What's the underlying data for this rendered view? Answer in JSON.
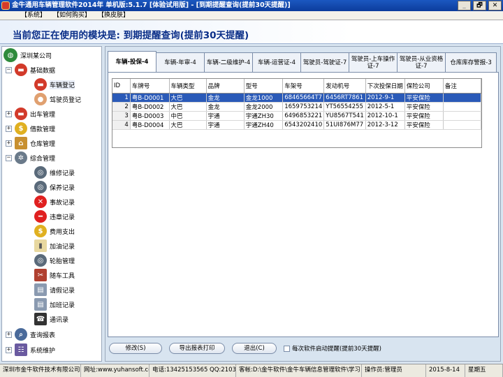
{
  "window": {
    "title": "金牛通用车辆管理软件2014年 单机版:5.1.7 [体验试用版] - [到期提醒查询(提前30天提醒)]",
    "buttons": [
      "_",
      "🗗",
      "✕"
    ]
  },
  "menu": [
    "【系统】",
    "【如何购买】",
    "【换皮肤】"
  ],
  "banner": "当前您正在使用的模块是: 到期提醒查询(提前30天提醒)",
  "tree": {
    "root": "深圳某公司",
    "items": [
      {
        "label": "基础数据",
        "toggle": "−"
      },
      {
        "label": "车辆登记"
      },
      {
        "label": "驾驶员登记"
      },
      {
        "label": "出车管理",
        "toggle": "+"
      },
      {
        "label": "借款管理",
        "toggle": "+"
      },
      {
        "label": "仓库管理",
        "toggle": "+"
      },
      {
        "label": "综合管理",
        "toggle": "−"
      },
      {
        "label": "维修记录"
      },
      {
        "label": "保养记录"
      },
      {
        "label": "事故记录"
      },
      {
        "label": "违章记录"
      },
      {
        "label": "费用支出"
      },
      {
        "label": "加油记录"
      },
      {
        "label": "轮胎管理"
      },
      {
        "label": "随车工具"
      },
      {
        "label": "请假记录"
      },
      {
        "label": "加班记录"
      },
      {
        "label": "通讯录"
      },
      {
        "label": "查询报表",
        "toggle": "+"
      },
      {
        "label": "系统维护",
        "toggle": "+"
      }
    ]
  },
  "tabs": [
    "车辆-投保-4",
    "车辆-年审-4",
    "车辆-二级维护-4",
    "车辆-运营证-4",
    "驾驶员-驾驶证-7",
    "驾驶员-上车操作证-7",
    "驾驶员-从业资格证-7",
    "仓库库存警报-3"
  ],
  "table": {
    "columns": [
      "ID",
      "车牌号",
      "车辆类型",
      "品牌",
      "型号",
      "车架号",
      "发动机号",
      "下次投保日期",
      "保险公司",
      "备注"
    ],
    "rows": [
      [
        "1",
        "粤B-D0001",
        "大巴",
        "金龙",
        "金龙1000",
        "68465664T7",
        "6456RT7861",
        "2012-9-1",
        "平安保险",
        ""
      ],
      [
        "2",
        "粤B-D0002",
        "大巴",
        "金龙",
        "金龙2000",
        "1659753214",
        "YT56554255",
        "2012-5-1",
        "平安保险",
        ""
      ],
      [
        "3",
        "粤B-D0003",
        "中巴",
        "宇通",
        "宇通ZH30",
        "6496853221",
        "YU8567T541",
        "2012-10-1",
        "平安保险",
        ""
      ],
      [
        "4",
        "粤B-D0004",
        "大巴",
        "宇通",
        "宇通ZH40",
        "6543202410",
        "51UI876M77",
        "2012-3-12",
        "平安保险",
        ""
      ]
    ]
  },
  "buttons": {
    "edit": "修改(S)",
    "export": "导出报表打印",
    "exit": "退出(C)",
    "startup_check": "每次软件启动提醒(提前30天提醒)"
  },
  "status": {
    "company": "深圳市金牛软件技术有限公司",
    "website": "网址:www.yuhansoft.com",
    "phone": "电话:13425153565 QQ:21035391",
    "path": "客帐:D:\\金牛软件\\金牛车辆信息管理软件\\学习",
    "operator": "操作员:管理员",
    "date": "2015-8-14",
    "weekday": "星期五"
  },
  "colors": {
    "selection": "#2a5ab8",
    "titlebar": "#1b58c0",
    "banner_text": "#0a2e88"
  }
}
